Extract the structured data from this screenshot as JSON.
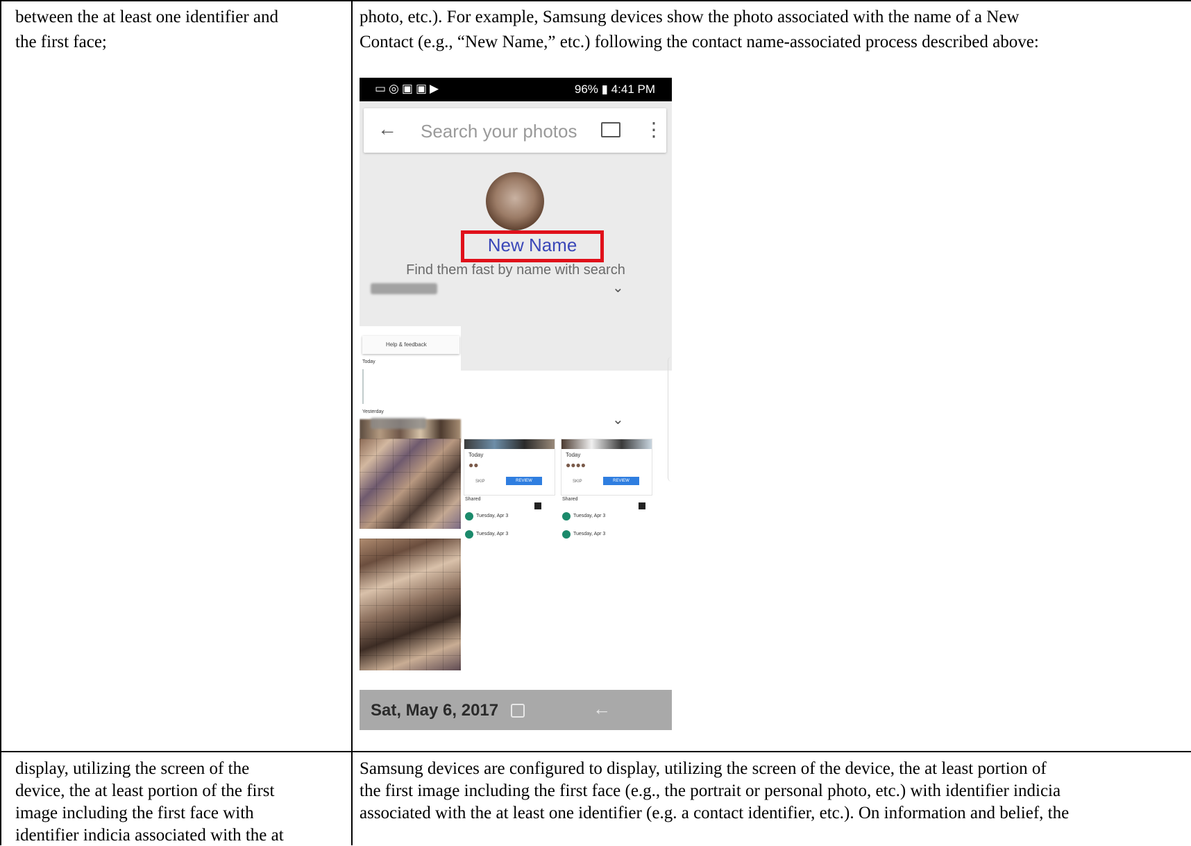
{
  "rows": [
    {
      "left_lines": [
        "between the at least one identifier and",
        "the first face;"
      ],
      "right_lines": [
        "photo, etc.). For example, Samsung devices show the photo associated with the name of a New",
        "Contact (e.g., “New Name,” etc.) following the contact name-associated process described above:"
      ]
    },
    {
      "left_lines": [
        "display, utilizing the screen of the",
        "device, the at least portion of the first",
        "image including the first face with",
        "identifier indicia associated with the at"
      ],
      "right_lines": [
        "Samsung devices are configured to display, utilizing the screen of the device, the at least portion of",
        "the first image including the first face (e.g., the portrait or personal photo, etc.) with identifier indicia",
        "associated with the at least one identifier (e.g. a contact identifier, etc.). On information and belief, the"
      ]
    }
  ],
  "screenshot": {
    "status_bar": {
      "right_text": "96% ▮ 4:41 PM",
      "icons": [
        "notification-icons"
      ]
    },
    "search": {
      "back_icon": "arrow-left-icon",
      "placeholder": "Search your photos",
      "cast_icon": "cast-icon",
      "more_icon": "more-vert-icon"
    },
    "contact": {
      "name": "New Name",
      "hint": "Find them fast by name with search",
      "highlight_color": "#e0101a"
    },
    "mini_panel": {
      "menu_item": "Help & feedback",
      "today": "Today",
      "yesterday": "Yesterday"
    },
    "cards": [
      {
        "date_label": "Today",
        "skip": "SKIP",
        "review": "REVIEW",
        "shared": "Shared",
        "item1": "Tuesday, Apr 3",
        "item2": "Tuesday, Apr 3"
      },
      {
        "date_label": "Today",
        "skip": "SKIP",
        "review": "REVIEW",
        "shared": "Shared",
        "item1": "Tuesday, Apr 3",
        "item2": "Tuesday, Apr 3"
      }
    ],
    "bottom_bar": {
      "date": "Sat, May 6, 2017"
    }
  }
}
